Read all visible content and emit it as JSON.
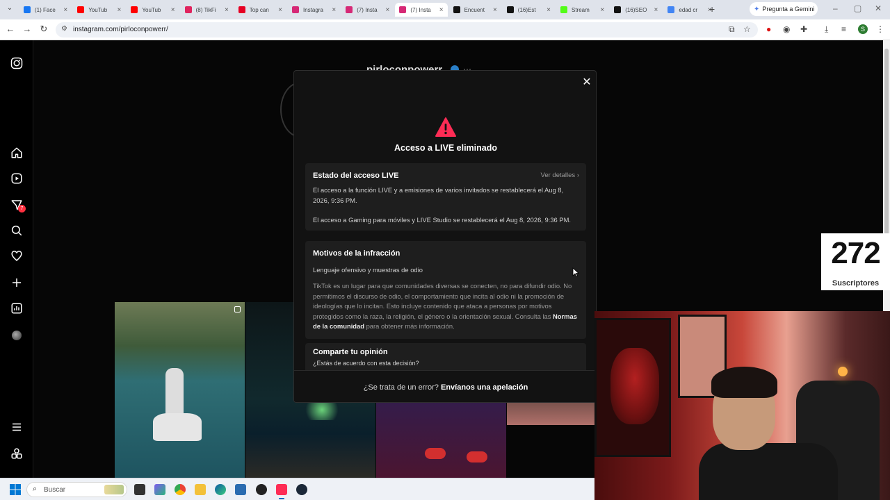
{
  "browser": {
    "tabs": [
      {
        "label": "(1) Face",
        "color": "#1877f2"
      },
      {
        "label": "YouTub",
        "color": "#ff0000"
      },
      {
        "label": "YouTub",
        "color": "#ff0000"
      },
      {
        "label": "(8) TikFi",
        "color": "#e0245e"
      },
      {
        "label": "Top can",
        "color": "#e60023"
      },
      {
        "label": "Instagra",
        "color": "#d62976"
      },
      {
        "label": "(7) Insta",
        "color": "#d62976"
      },
      {
        "label": "(7) Insta",
        "color": "#d62976"
      },
      {
        "label": "Encuent",
        "color": "#111111"
      },
      {
        "label": "(16)Est",
        "color": "#111111"
      },
      {
        "label": "Stream",
        "color": "#53fc18"
      },
      {
        "label": "(16)SEO",
        "color": "#111111"
      },
      {
        "label": "edad cr",
        "color": "#4285f4"
      }
    ],
    "active_tab_index": 7,
    "gemini_label": "Pregunta a Gemini",
    "url": "instagram.com/pirloconpowerr/",
    "profile_initial": "S"
  },
  "instagram": {
    "notification_count": "7",
    "username": "pirloconpowerr",
    "more": "···"
  },
  "modal": {
    "title": "Acceso a LIVE eliminado",
    "status": {
      "heading": "Estado del acceso LIVE",
      "details_link": "Ver detalles",
      "line1": "El acceso a la función LIVE y a emisiones de varios invitados se restablecerá el Aug 8, 2026, 9:36 PM.",
      "line2": "El acceso a Gaming para móviles y LIVE Studio se restablecerá el Aug 8, 2026, 9:36 PM."
    },
    "reasons": {
      "heading": "Motivos de la infracción",
      "subtitle": "Lenguaje ofensivo y muestras de odio",
      "body": "TikTok es un lugar para que comunidades diversas se conecten, no para difundir odio. No permitimos el discurso de odio, el comportamiento que incita al odio ni la promoción de ideologías que lo incitan. Esto incluye contenido que ataca a personas por motivos protegidos como la raza, la religión, el género o la orientación sexual. Consulta las",
      "link": "Normas de la comunidad",
      "tail": "para obtener más información."
    },
    "opinion": {
      "heading": "Comparte tu opinión",
      "question": "¿Estás de acuerdo con esta decisión?"
    },
    "footer": {
      "question": "¿Se trata de un error?",
      "link": "Envíanos una apelación"
    }
  },
  "overlay": {
    "subscribers": "272",
    "subscribers_label": "Suscriptores"
  },
  "taskbar": {
    "search_placeholder": "Buscar"
  }
}
